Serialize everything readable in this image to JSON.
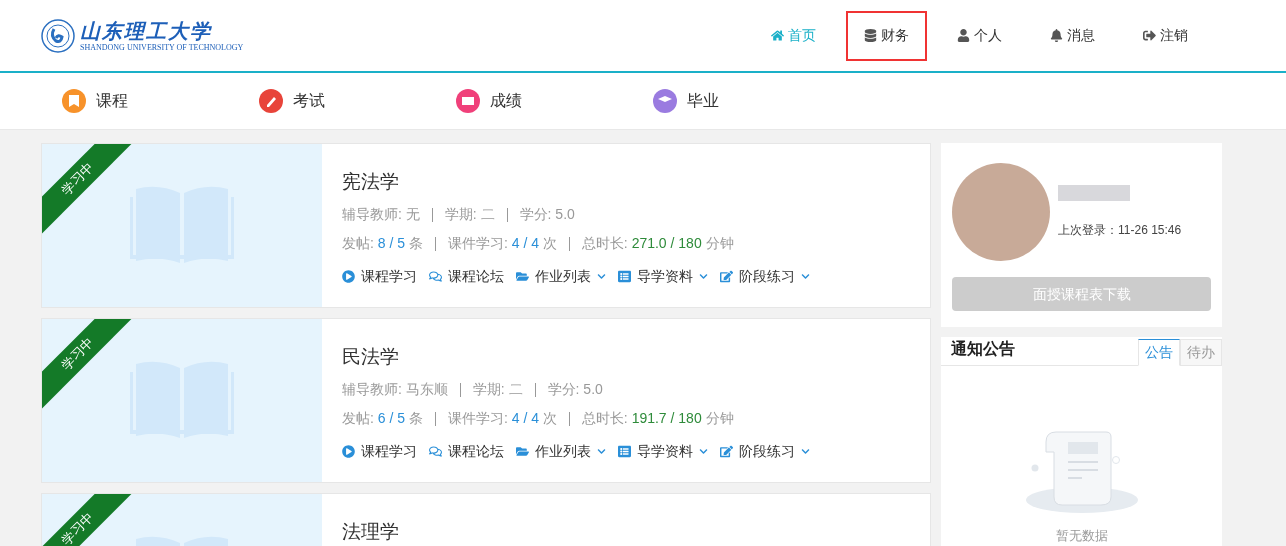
{
  "logo": {
    "name": "山东理工大学",
    "subtitle": "SHANDONG UNIVERSITY OF TECHNOLOGY"
  },
  "nav": [
    {
      "kind": "home",
      "label": "首页",
      "selected": true,
      "highlighted": false
    },
    {
      "kind": "finance",
      "label": "财务",
      "selected": false,
      "highlighted": true
    },
    {
      "kind": "user",
      "label": "个人",
      "selected": false,
      "highlighted": false
    },
    {
      "kind": "bell",
      "label": "消息",
      "selected": false,
      "highlighted": false
    },
    {
      "kind": "logout",
      "label": "注销",
      "selected": false,
      "highlighted": false
    }
  ],
  "subnav": [
    {
      "kind": "course",
      "label": "课程",
      "color": "#f7922a"
    },
    {
      "kind": "exam",
      "label": "考试",
      "color": "#e8443a"
    },
    {
      "kind": "score",
      "label": "成绩",
      "color": "#f0407a"
    },
    {
      "kind": "graduate",
      "label": "毕业",
      "color": "#9a7be0"
    }
  ],
  "courses": [
    {
      "ribbon": "学习中",
      "title": "宪法学",
      "meta": [
        {
          "label": "辅导教师:",
          "value": "无"
        },
        {
          "label": "学期:",
          "value": "二"
        },
        {
          "label": "学分:",
          "value": "5.0"
        }
      ],
      "stats": [
        {
          "label": "发帖:",
          "value": "8 / 5",
          "unit": "条",
          "color": "#2a8fd8"
        },
        {
          "label": "课件学习:",
          "value": "4 / 4",
          "unit": "次",
          "color": "#2a8fd8"
        },
        {
          "label": "总时长:",
          "value": "271.0 / 180",
          "unit": "分钟",
          "color": "#2e8b3a"
        }
      ],
      "actions": [
        {
          "kind": "play",
          "label": "课程学习",
          "dropdown": false
        },
        {
          "kind": "chat",
          "label": "课程论坛",
          "dropdown": false
        },
        {
          "kind": "folder",
          "label": "作业列表",
          "dropdown": true
        },
        {
          "kind": "list",
          "label": "导学资料",
          "dropdown": true
        },
        {
          "kind": "edit",
          "label": "阶段练习",
          "dropdown": true
        }
      ]
    },
    {
      "ribbon": "学习中",
      "title": "民法学",
      "meta": [
        {
          "label": "辅导教师:",
          "value": "马东顺"
        },
        {
          "label": "学期:",
          "value": "二"
        },
        {
          "label": "学分:",
          "value": "5.0"
        }
      ],
      "stats": [
        {
          "label": "发帖:",
          "value": "6 / 5",
          "unit": "条",
          "color": "#2a8fd8"
        },
        {
          "label": "课件学习:",
          "value": "4 / 4",
          "unit": "次",
          "color": "#2a8fd8"
        },
        {
          "label": "总时长:",
          "value": "191.7 / 180",
          "unit": "分钟",
          "color": "#2e8b3a"
        }
      ],
      "actions": [
        {
          "kind": "play",
          "label": "课程学习",
          "dropdown": false
        },
        {
          "kind": "chat",
          "label": "课程论坛",
          "dropdown": false
        },
        {
          "kind": "folder",
          "label": "作业列表",
          "dropdown": true
        },
        {
          "kind": "list",
          "label": "导学资料",
          "dropdown": true
        },
        {
          "kind": "edit",
          "label": "阶段练习",
          "dropdown": true
        }
      ]
    },
    {
      "ribbon": "学习中",
      "title": "法理学"
    }
  ],
  "profile": {
    "last_login": "上次登录：11-26 15:46",
    "download_button": "面授课程表下载"
  },
  "notice": {
    "title": "通知公告",
    "tabs": [
      {
        "label": "公告",
        "selected": true
      },
      {
        "label": "待办",
        "selected": false
      }
    ],
    "empty_text": "暂无数据"
  }
}
